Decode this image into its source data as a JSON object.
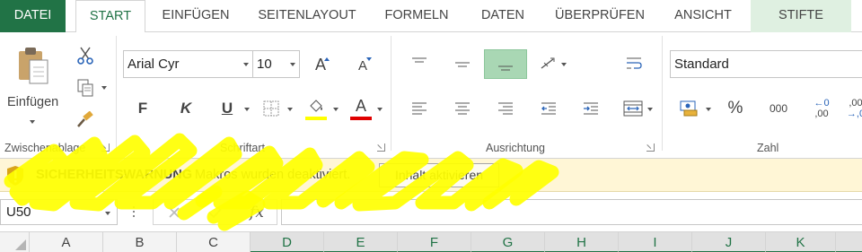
{
  "tabs": [
    {
      "label": "DATEI"
    },
    {
      "label": "START"
    },
    {
      "label": "EINFÜGEN"
    },
    {
      "label": "SEITENLAYOUT"
    },
    {
      "label": "FORMELN"
    },
    {
      "label": "DATEN"
    },
    {
      "label": "ÜBERPRÜFEN"
    },
    {
      "label": "ANSICHT"
    },
    {
      "label": "STIFTE"
    }
  ],
  "clipboard": {
    "paste_label": "Einfügen",
    "group_label": "Zwischenablage"
  },
  "font": {
    "font_name": "Arial Cyr",
    "font_size": "10",
    "grow_glyph": "A",
    "shrink_glyph": "A",
    "bold_glyph": "F",
    "italic_glyph": "K",
    "underline_glyph": "U",
    "fontcolor_glyph": "A",
    "group_label": "Schriftart",
    "highlight_color": "#ffff00",
    "font_color": "#e00000"
  },
  "alignment": {
    "group_label": "Ausrichtung"
  },
  "number": {
    "format": "Standard",
    "percent_glyph": "%",
    "thousands_glyph": "000",
    "inc_decimal_top": "←0",
    "inc_decimal_bottom": ",00",
    "dec_decimal_top": ",00",
    "dec_decimal_bottom": "→,0",
    "group_label": "Zahl"
  },
  "security": {
    "title": "SICHERHEITSWARNUNG",
    "message": "Makros wurden deaktiviert.",
    "button_label": "Inhalt aktivieren"
  },
  "formula_bar": {
    "name_box": "U50",
    "fx_label": "fx",
    "formula": ""
  },
  "columns": [
    "A",
    "B",
    "C",
    "D",
    "E",
    "F",
    "G",
    "H",
    "I",
    "J",
    "K"
  ],
  "selected_columns": [
    "D",
    "E",
    "F",
    "G",
    "H",
    "I",
    "J",
    "K"
  ],
  "colors": {
    "brand_green": "#217346",
    "ribbon_bg": "#ffffff",
    "security_bg": "#fff6d6",
    "scribble": "#ffff00",
    "paste_icon_accent": "#f0b85a"
  }
}
